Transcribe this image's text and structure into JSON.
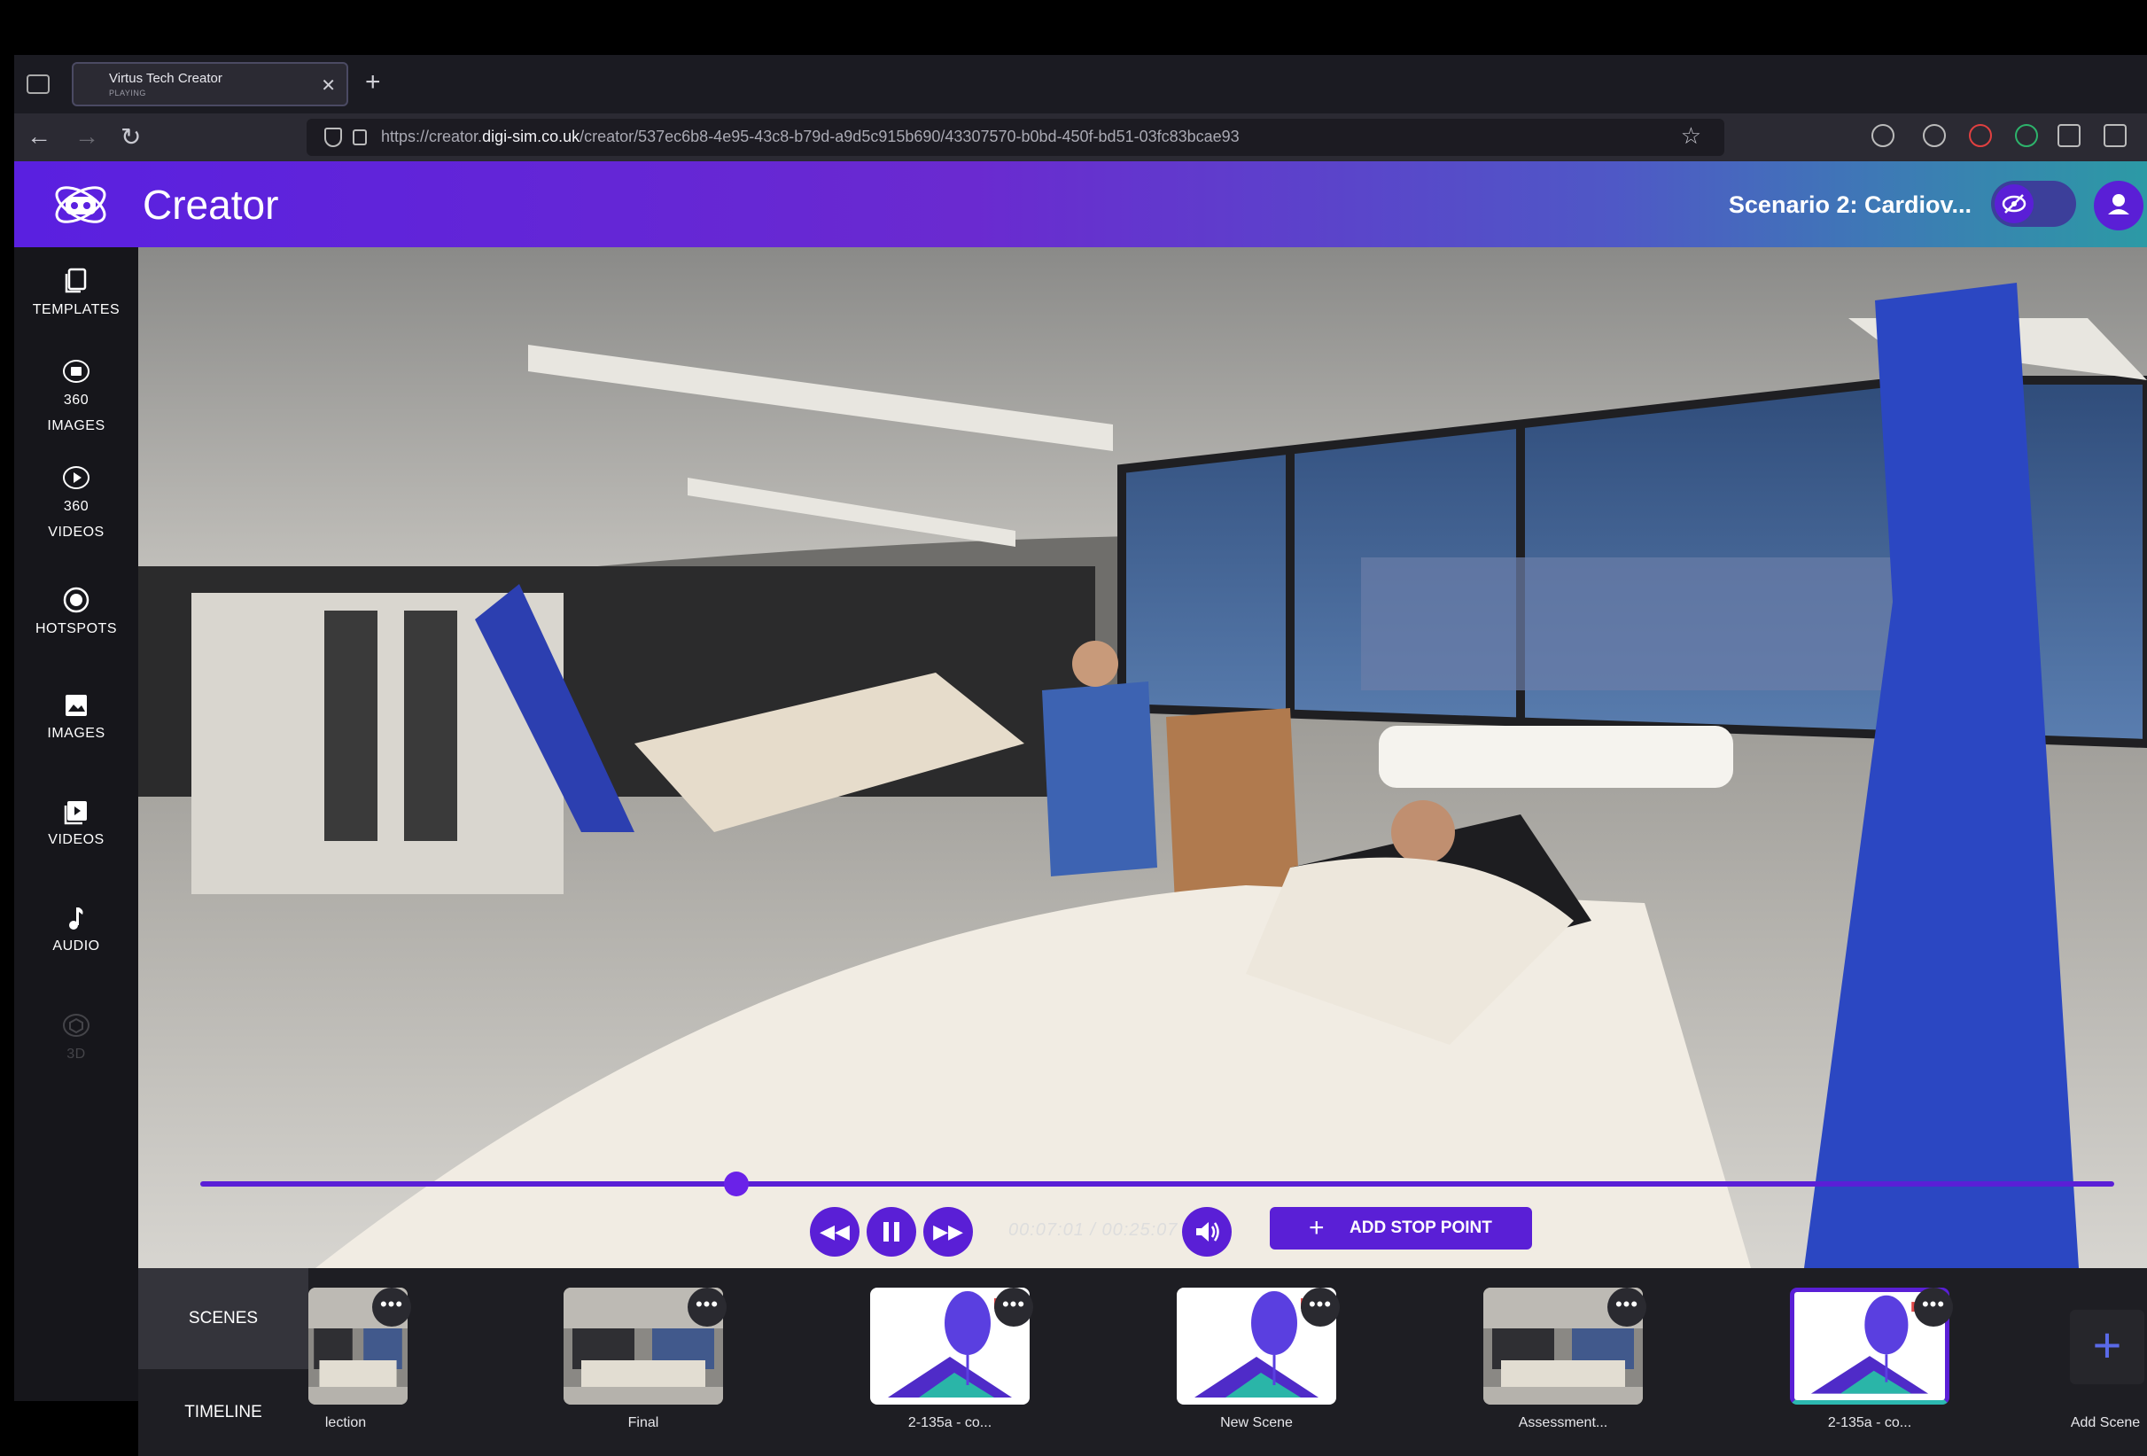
{
  "browser": {
    "tab_title": "Virtus Tech Creator",
    "tab_status": "PLAYING",
    "url_prefix": "https://creator.",
    "url_domain": "digi-sim.co.uk",
    "url_path": "/creator/537ec6b8-4e95-43c8-b79d-a9d5c915b690/43307570-b0bd-450f-bd51-03fc83bcae93"
  },
  "header": {
    "app_title": "Creator",
    "scenario_title": "Scenario 2: Cardiov..."
  },
  "sidebar": {
    "items": [
      {
        "label": "TEMPLATES"
      },
      {
        "label_line1": "360",
        "label_line2": "IMAGES"
      },
      {
        "label_line1": "360",
        "label_line2": "VIDEOS"
      },
      {
        "label": "HOTSPOTS"
      },
      {
        "label": "IMAGES"
      },
      {
        "label": "VIDEOS"
      },
      {
        "label": "AUDIO"
      },
      {
        "label": "3D",
        "disabled": true
      }
    ]
  },
  "player": {
    "progress": 0.28,
    "time": "00:07:01 / 00:25:07",
    "add_stop_label": "ADD STOP POINT"
  },
  "bottom": {
    "tabs": {
      "scenes": "SCENES",
      "timeline": "TIMELINE"
    },
    "scenes": [
      {
        "label": "lection",
        "type": "photo",
        "selected": false
      },
      {
        "label": "Final",
        "type": "photo",
        "selected": false
      },
      {
        "label": "2-135a - co...",
        "type": "placeholder",
        "selected": false
      },
      {
        "label": "New Scene",
        "type": "placeholder",
        "selected": false
      },
      {
        "label": "Assessment...",
        "type": "photo",
        "selected": false
      },
      {
        "label": "2-135a - co...",
        "type": "placeholder",
        "selected": true
      }
    ],
    "add_scene_label": "Add Scene"
  },
  "colors": {
    "accent": "#5a1fd6",
    "header_gradient_start": "#5a20e0",
    "header_gradient_end": "#2c9aa5"
  }
}
